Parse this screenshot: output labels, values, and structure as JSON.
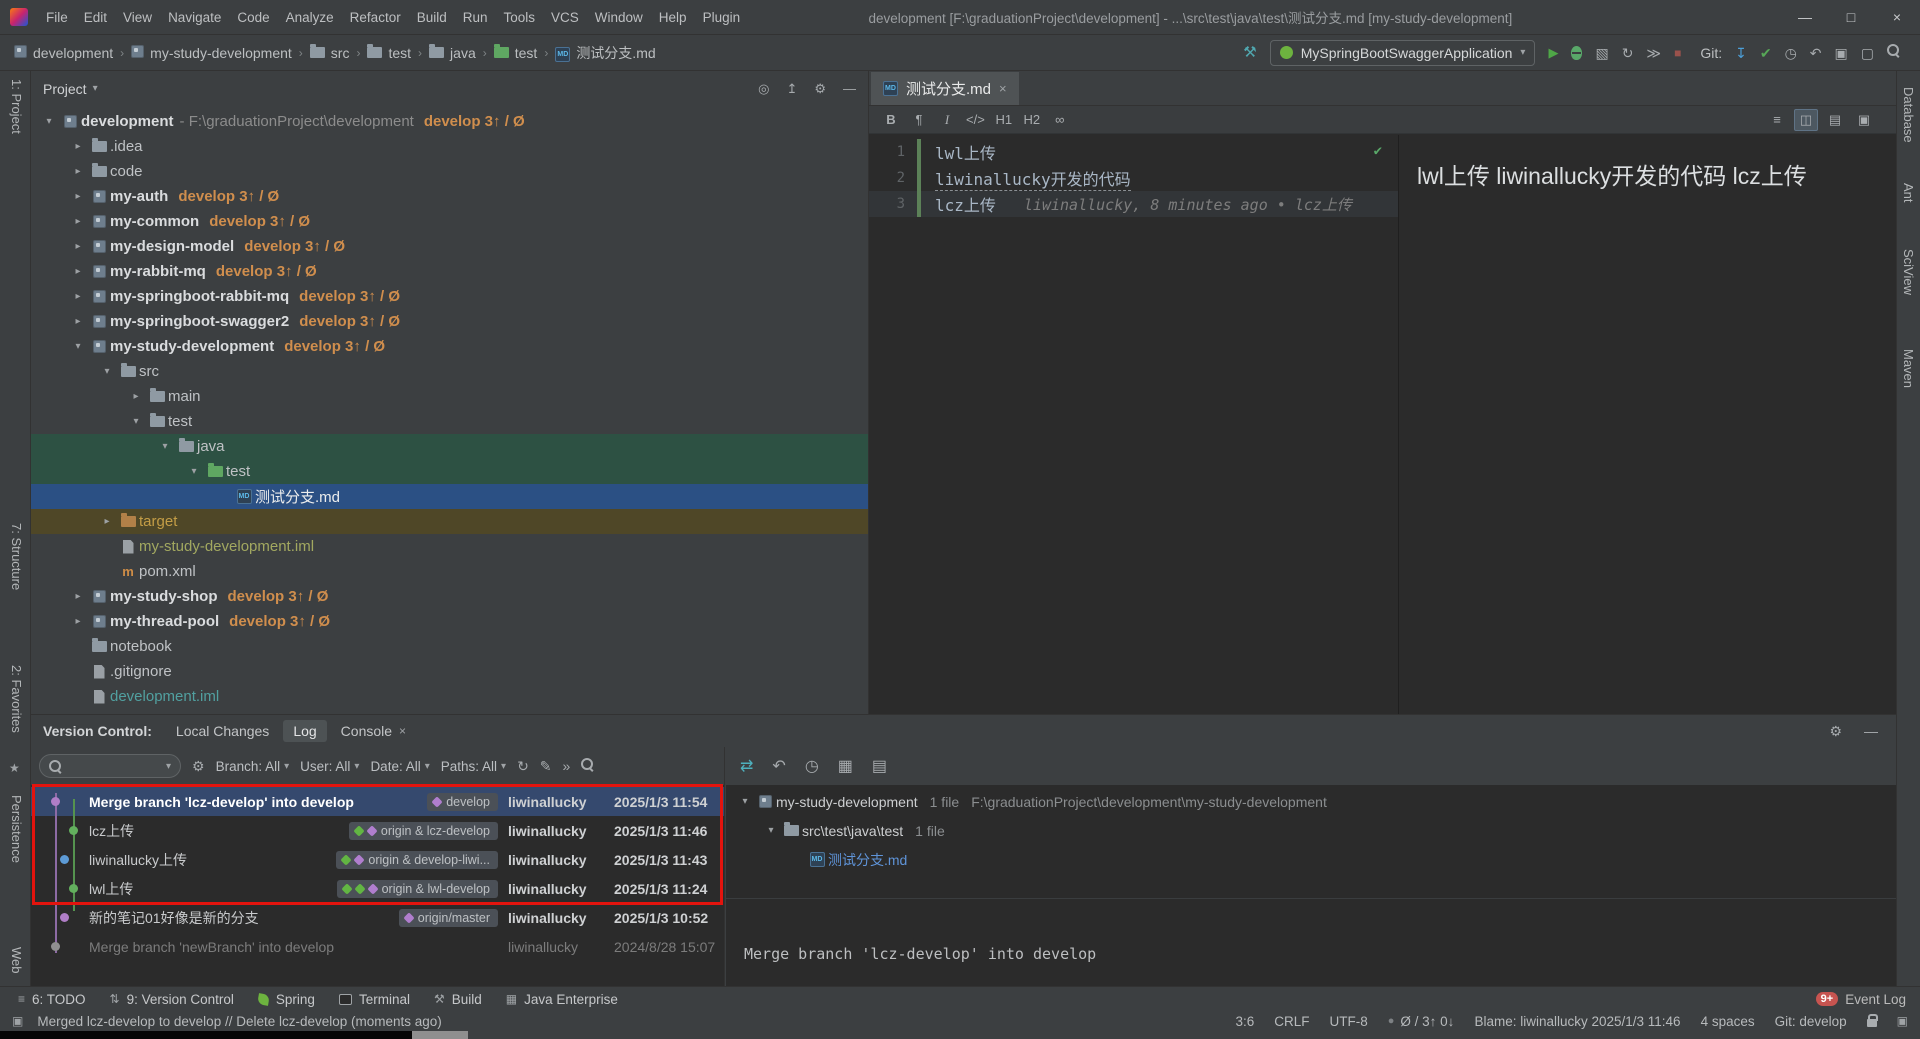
{
  "title_bar": {
    "menus": [
      "File",
      "Edit",
      "View",
      "Navigate",
      "Code",
      "Analyze",
      "Refactor",
      "Build",
      "Run",
      "Tools",
      "VCS",
      "Window",
      "Help",
      "Plugin"
    ],
    "title": "development [F:\\graduationProject\\development] - ...\\src\\test\\java\\test\\测试分支.md [my-study-development]",
    "window_controls": [
      "minimize",
      "maximize",
      "close"
    ]
  },
  "toolbar": {
    "breadcrumbs": [
      {
        "label": "development",
        "icon": "module"
      },
      {
        "label": "my-study-development",
        "icon": "module"
      },
      {
        "label": "src",
        "icon": "folder"
      },
      {
        "label": "test",
        "icon": "folder"
      },
      {
        "label": "java",
        "icon": "folder"
      },
      {
        "label": "test",
        "icon": "folder-green"
      },
      {
        "label": "测试分支.md",
        "icon": "md-file"
      }
    ],
    "run_config": "MySpringBootSwaggerApplication",
    "git_label": "Git:"
  },
  "left_stripe": [
    "1: Project",
    "7: Structure",
    "2: Favorites",
    "Persistence",
    "Web"
  ],
  "right_stripe": [
    "Database",
    "Ant",
    "SciView",
    "Maven"
  ],
  "project": {
    "header": "Project",
    "tree": [
      {
        "depth": 0,
        "arrow": "open",
        "icon": "module",
        "text": "development",
        "suffix": " - F:\\graduationProject\\development",
        "branch": "develop 3↑ / Ø",
        "bold": true
      },
      {
        "depth": 1,
        "arrow": "closed",
        "icon": "folder",
        "text": ".idea"
      },
      {
        "depth": 1,
        "arrow": "closed",
        "icon": "folder",
        "text": "code"
      },
      {
        "depth": 1,
        "arrow": "closed",
        "icon": "module",
        "text": "my-auth",
        "branch": "develop 3↑ / Ø",
        "bold": true
      },
      {
        "depth": 1,
        "arrow": "closed",
        "icon": "module",
        "text": "my-common",
        "branch": "develop 3↑ / Ø",
        "bold": true
      },
      {
        "depth": 1,
        "arrow": "closed",
        "icon": "module",
        "text": "my-design-model",
        "branch": "develop 3↑ / Ø",
        "bold": true
      },
      {
        "depth": 1,
        "arrow": "closed",
        "icon": "module",
        "text": "my-rabbit-mq",
        "branch": "develop 3↑ / Ø",
        "bold": true
      },
      {
        "depth": 1,
        "arrow": "closed",
        "icon": "module",
        "text": "my-springboot-rabbit-mq",
        "branch": "develop 3↑ / Ø",
        "bold": true
      },
      {
        "depth": 1,
        "arrow": "closed",
        "icon": "module",
        "text": "my-springboot-swagger2",
        "branch": "develop 3↑ / Ø",
        "bold": true
      },
      {
        "depth": 1,
        "arrow": "open",
        "icon": "module",
        "text": "my-study-development",
        "branch": "develop 3↑ / Ø",
        "bold": true
      },
      {
        "depth": 2,
        "arrow": "open",
        "icon": "folder",
        "text": "src"
      },
      {
        "depth": 3,
        "arrow": "closed",
        "icon": "folder",
        "text": "main"
      },
      {
        "depth": 3,
        "arrow": "open",
        "icon": "folder",
        "text": "test"
      },
      {
        "depth": 4,
        "arrow": "open",
        "icon": "folder",
        "text": "java",
        "row_bg": "green"
      },
      {
        "depth": 5,
        "arrow": "open",
        "icon": "folder-green",
        "text": "test",
        "row_bg": "green"
      },
      {
        "depth": 6,
        "icon": "md-file",
        "text": "测试分支.md",
        "row_bg": "selected"
      },
      {
        "depth": 2,
        "arrow": "closed",
        "icon": "folder-excluded",
        "text": "target",
        "row_bg": "amber",
        "text_color": "#c49d46"
      },
      {
        "depth": 2,
        "icon": "file",
        "text": "my-study-development.iml",
        "text_color": "#a2a860"
      },
      {
        "depth": 2,
        "icon": "maven",
        "text": "pom.xml"
      },
      {
        "depth": 1,
        "arrow": "closed",
        "icon": "module",
        "text": "my-study-shop",
        "branch": "develop 3↑ / Ø",
        "bold": true
      },
      {
        "depth": 1,
        "arrow": "closed",
        "icon": "module",
        "text": "my-thread-pool",
        "branch": "develop 3↑ / Ø",
        "bold": true
      },
      {
        "depth": 1,
        "icon": "folder",
        "text": "notebook"
      },
      {
        "depth": 1,
        "icon": "file",
        "text": ".gitignore"
      },
      {
        "depth": 1,
        "icon": "file",
        "text": "development.iml",
        "text_color": "#51a0a0"
      }
    ]
  },
  "editor": {
    "tab": "测试分支.md",
    "lines": [
      {
        "num": "1",
        "text": "lwl上传"
      },
      {
        "num": "2",
        "text": "liwinallucky开发的代码",
        "underline": true
      },
      {
        "num": "3",
        "text": "lcz上传",
        "blame": "liwinallucky, 8 minutes ago • lcz上传",
        "current": true
      }
    ],
    "preview": "lwl上传 liwinallucky开发的代码 lcz上传"
  },
  "vcs": {
    "label": "Version Control:",
    "tabs": [
      "Local Changes",
      "Log",
      "Console"
    ],
    "active_tab": "Log",
    "filters": [
      "Branch: All",
      "User: All",
      "Date: All",
      "Paths: All"
    ],
    "commits": [
      {
        "message": "Merge branch 'lcz-develop' into develop",
        "refs": {
          "label": "develop",
          "tags": [
            "purple"
          ]
        },
        "user": "liwinallucky",
        "date": "2025/1/3 11:54",
        "selected": true
      },
      {
        "message": "lcz上传",
        "refs": {
          "label": "origin & lcz-develop",
          "tags": [
            "green",
            "purple"
          ]
        },
        "user": "liwinallucky",
        "date": "2025/1/3 11:46"
      },
      {
        "message": "liwinallucky上传",
        "refs": {
          "label": "origin & develop-liwi...",
          "tags": [
            "green",
            "purple"
          ]
        },
        "user": "liwinallucky",
        "date": "2025/1/3 11:43"
      },
      {
        "message": "lwl上传",
        "refs": {
          "label": "origin & lwl-develop",
          "tags": [
            "green",
            "green",
            "purple"
          ]
        },
        "user": "liwinallucky",
        "date": "2025/1/3 11:24"
      },
      {
        "message": "新的笔记01好像是新的分支",
        "refs": {
          "label": "origin/master",
          "tags": [
            "purple"
          ]
        },
        "user": "liwinallucky",
        "date": "2025/1/3 10:52"
      },
      {
        "message": "Merge branch 'newBranch' into develop",
        "user": "liwinallucky",
        "date": "2024/8/28 15:07",
        "dimmed": true
      }
    ],
    "details": {
      "files": [
        {
          "depth": 0,
          "arrow": "open",
          "icon": "module",
          "name": "my-study-development",
          "count": "1 file",
          "path": "F:\\graduationProject\\development\\my-study-development"
        },
        {
          "depth": 1,
          "arrow": "open",
          "icon": "folder",
          "name": "src\\test\\java\\test",
          "count": "1 file"
        },
        {
          "depth": 2,
          "icon": "md-file",
          "name": "测试分支.md",
          "modified": true
        }
      ],
      "message": "Merge branch 'lcz-develop' into develop"
    }
  },
  "bottom_bar": {
    "left": [
      {
        "icon": "todo",
        "label": "6: TODO"
      },
      {
        "icon": "vcs",
        "label": "9: Version Control"
      },
      {
        "icon": "spring",
        "label": "Spring"
      },
      {
        "icon": "terminal",
        "label": "Terminal"
      },
      {
        "icon": "build",
        "label": "Build"
      },
      {
        "icon": "javaee",
        "label": "Java Enterprise"
      }
    ],
    "event_log": {
      "badge": "9+",
      "label": "Event Log"
    }
  },
  "status_bar": {
    "message": "Merged lcz-develop to develop // Delete lcz-develop (moments ago)",
    "caret": "3:6",
    "line_ending": "CRLF",
    "encoding": "UTF-8",
    "git_counters": "Ø / 3↑ 0↓",
    "blame": "Blame: liwinallucky 2025/1/3 11:46",
    "indent": "4 spaces",
    "branch": "Git: develop"
  }
}
